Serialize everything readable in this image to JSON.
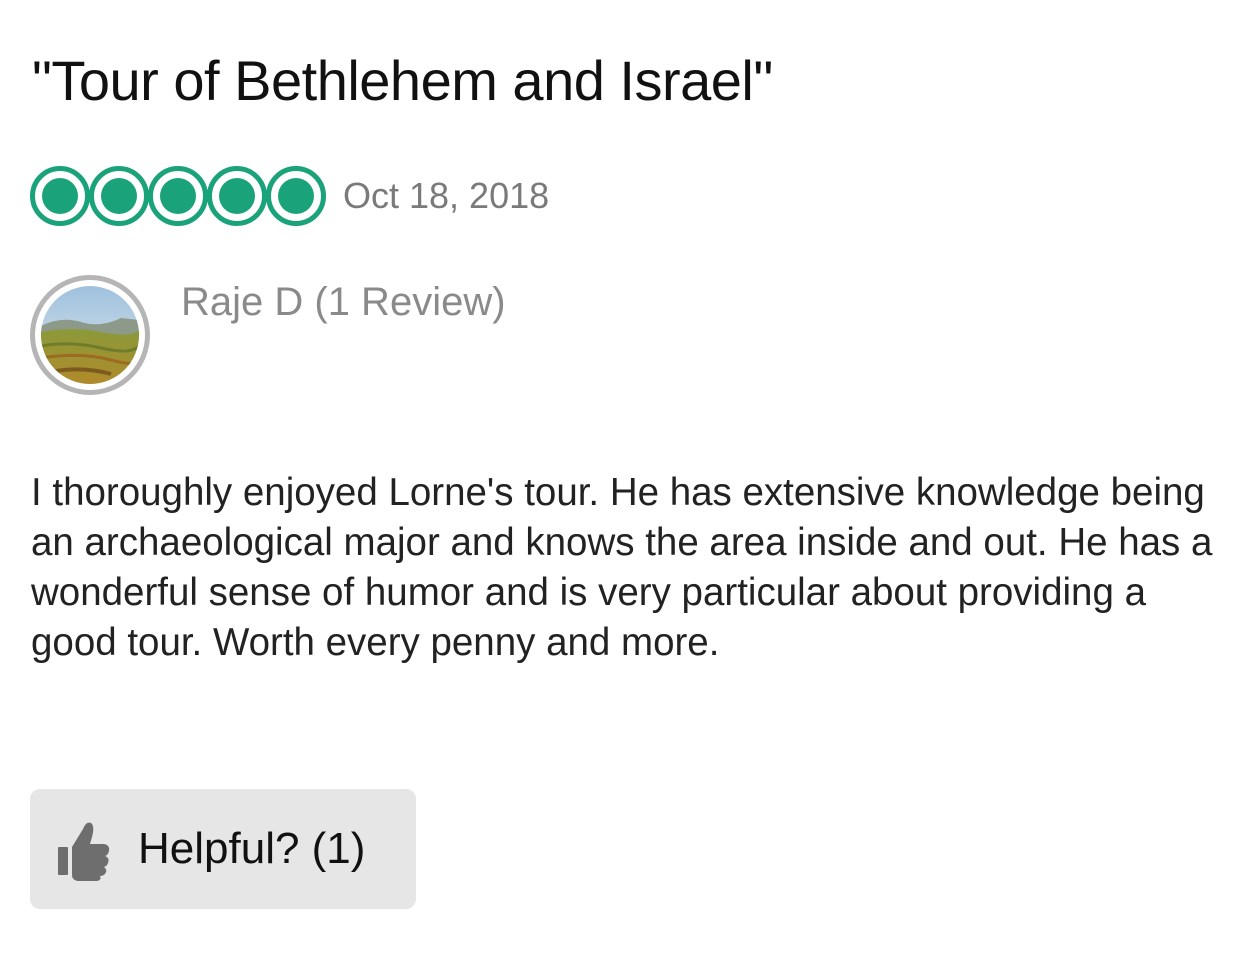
{
  "review": {
    "title": "\"Tour of Bethlehem and Israel\"",
    "rating": 5,
    "rating_max": 5,
    "date": "Oct 18, 2018",
    "reviewer": {
      "name_line": "Raje D (1 Review)"
    },
    "body": "I thoroughly enjoyed Lorne's tour. He has extensive knowledge being an archaeological major and knows the area inside and out.  He has a wonderful sense of humor and is very particular about providing a good tour.  Worth every penny and more.",
    "helpful": {
      "label": "Helpful? (1)",
      "icon": "thumbs-up-icon"
    }
  },
  "colors": {
    "rating_bubble": "#1aa37a",
    "secondary_text": "#8a8a8a",
    "button_bg": "#e6e6e6"
  }
}
